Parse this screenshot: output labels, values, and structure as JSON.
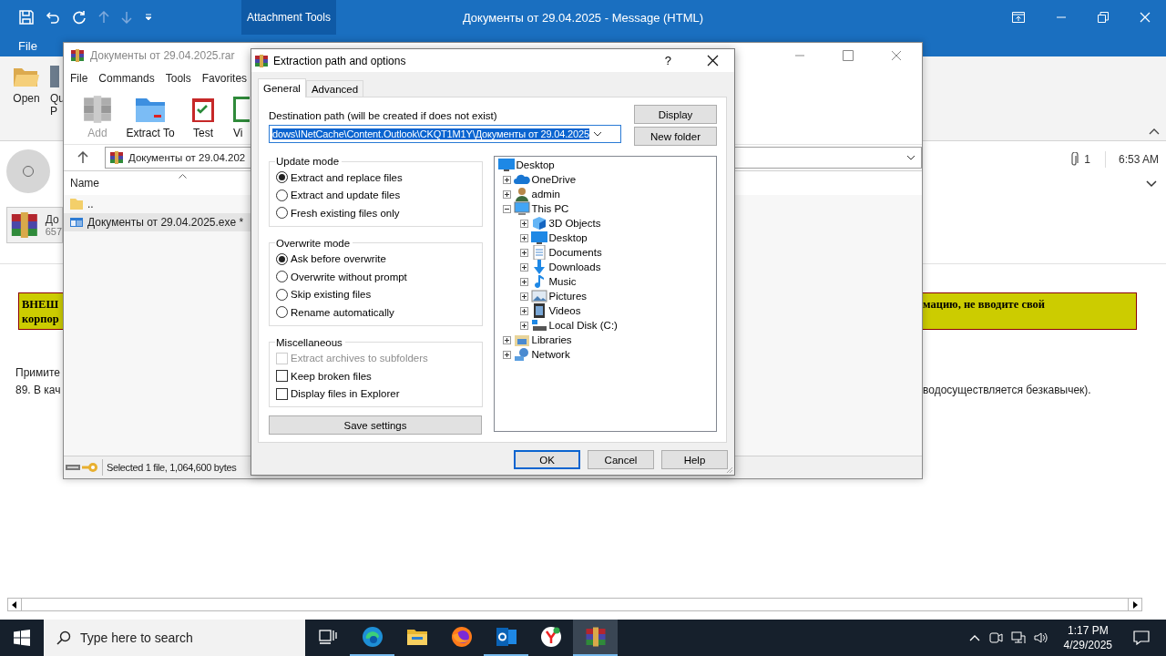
{
  "outlook": {
    "title": "Документы от 29.04.2025  -  Message (HTML)",
    "context_tab": "Attachment Tools",
    "tabs": [
      "File"
    ],
    "ribbon_buttons": [
      {
        "kind": "open",
        "lines": [
          "Open"
        ]
      },
      {
        "kind": "quick",
        "lines": [
          "Qu",
          "P"
        ]
      }
    ],
    "attachment": {
      "name": "До",
      "size": "657"
    },
    "attachment_count": "1",
    "received": "6:53 AM",
    "banner_left": [
      "ВНЕШ",
      "корпор"
    ],
    "banner_right": [
      "мацию, не вводите свой"
    ],
    "body_left": [
      "Примите",
      "89. В кач"
    ],
    "body_right": [
      "водосуществляется безкавычек)."
    ]
  },
  "archive": {
    "title": "Документы от 29.04.2025.rar",
    "menu": [
      "File",
      "Commands",
      "Tools",
      "Favorites"
    ],
    "toolbar": [
      {
        "kind": "add",
        "label": "Add",
        "disabled": true
      },
      {
        "kind": "extract",
        "label": "Extract To",
        "disabled": false
      },
      {
        "kind": "test",
        "label": "Test",
        "disabled": false
      },
      {
        "kind": "view",
        "label": "Vi",
        "disabled": false
      }
    ],
    "path": "Документы от 29.04.202",
    "column": "Name",
    "files": [
      {
        "kind": "folder",
        "name": "..",
        "selected": false
      },
      {
        "kind": "exe",
        "name": "Документы от 29.04.2025.exe *",
        "selected": true
      }
    ],
    "status": "Selected 1 file, 1,064,600 bytes"
  },
  "dialog": {
    "title": "Extraction path and options",
    "help": "?",
    "tabs": [
      {
        "label": "General",
        "selected": true
      },
      {
        "label": "Advanced",
        "selected": false
      }
    ],
    "dest_label": "Destination path (will be created if does not exist)",
    "dest_value": "dows\\INetCache\\Content.Outlook\\CKQT1M1Y\\Документы от 29.04.2025",
    "side_buttons": [
      "Display",
      "New folder"
    ],
    "groups": [
      {
        "title": "Update mode",
        "options": [
          {
            "kind": "radio",
            "label": "Extract and replace files",
            "selected": true,
            "disabled": false
          },
          {
            "kind": "radio",
            "label": "Extract and update files",
            "selected": false,
            "disabled": false
          },
          {
            "kind": "radio",
            "label": "Fresh existing files only",
            "selected": false,
            "disabled": false
          }
        ]
      },
      {
        "title": "Overwrite mode",
        "options": [
          {
            "kind": "radio",
            "label": "Ask before overwrite",
            "selected": true,
            "disabled": false
          },
          {
            "kind": "radio",
            "label": "Overwrite without prompt",
            "selected": false,
            "disabled": false
          },
          {
            "kind": "radio",
            "label": "Skip existing files",
            "selected": false,
            "disabled": false
          },
          {
            "kind": "radio",
            "label": "Rename automatically",
            "selected": false,
            "disabled": false
          }
        ]
      },
      {
        "title": "Miscellaneous",
        "options": [
          {
            "kind": "checkbox",
            "label": "Extract archives to subfolders",
            "checked": false,
            "disabled": true
          },
          {
            "kind": "checkbox",
            "label": "Keep broken files",
            "checked": false,
            "disabled": false
          },
          {
            "kind": "checkbox",
            "label": "Display files in Explorer",
            "checked": false,
            "disabled": false
          }
        ]
      }
    ],
    "save": "Save settings",
    "tree": [
      {
        "kind": "desktop",
        "label": "Desktop",
        "children": [
          {
            "kind": "cloud",
            "label": "OneDrive",
            "expanded": false
          },
          {
            "kind": "user",
            "label": "admin",
            "expanded": false
          },
          {
            "kind": "pc",
            "label": "This PC",
            "expanded": true,
            "children": [
              {
                "kind": "cube",
                "label": "3D Objects",
                "expanded": false
              },
              {
                "kind": "desktop",
                "label": "Desktop",
                "expanded": false
              },
              {
                "kind": "documents",
                "label": "Documents",
                "expanded": false
              },
              {
                "kind": "download",
                "label": "Downloads",
                "expanded": false
              },
              {
                "kind": "music",
                "label": "Music",
                "expanded": false
              },
              {
                "kind": "pictures",
                "label": "Pictures",
                "expanded": false
              },
              {
                "kind": "videos",
                "label": "Videos",
                "expanded": false
              },
              {
                "kind": "disk",
                "label": "Local Disk (C:)",
                "expanded": false
              }
            ]
          },
          {
            "kind": "libraries",
            "label": "Libraries",
            "expanded": false
          },
          {
            "kind": "network",
            "label": "Network",
            "expanded": false
          }
        ]
      }
    ],
    "buttons": [
      {
        "label": "OK",
        "default": true
      },
      {
        "label": "Cancel",
        "default": false
      },
      {
        "label": "Help",
        "default": false
      }
    ]
  },
  "taskbar": {
    "search_placeholder": "Type here to search",
    "apps": [
      {
        "kind": "taskview",
        "running": false,
        "selected": false
      },
      {
        "kind": "edge",
        "running": true,
        "selected": false
      },
      {
        "kind": "explorer",
        "running": false,
        "selected": false
      },
      {
        "kind": "firefox",
        "running": false,
        "selected": false
      },
      {
        "kind": "outlook",
        "running": true,
        "selected": false
      },
      {
        "kind": "yandex",
        "running": false,
        "selected": false
      },
      {
        "kind": "winrar",
        "running": true,
        "selected": true
      }
    ],
    "time": "1:17 PM",
    "date": "4/29/2025"
  }
}
